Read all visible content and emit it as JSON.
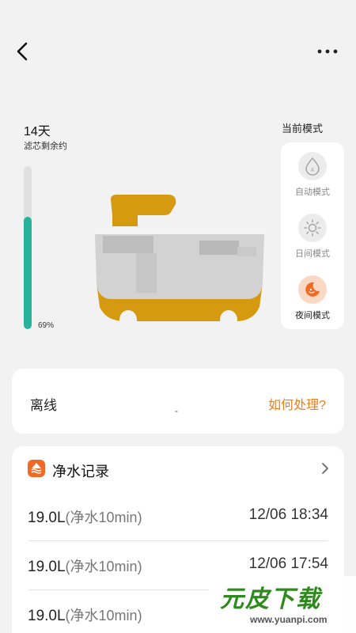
{
  "status_bar": {
    "left": "",
    "right": ""
  },
  "nav": {
    "back_icon": "chevron-left-icon",
    "more_icon": "more-horizontal-icon"
  },
  "filter": {
    "days_left": "14天",
    "label": "滤芯剩余约",
    "percent_text": "69%",
    "percent_value": 0.69,
    "fill_color": "#27b39b"
  },
  "device": {
    "image": "purifier-device-illustration",
    "accent_color": "#d69a10"
  },
  "modes": {
    "title": "当前模式",
    "items": [
      {
        "icon": "auto-mode-icon",
        "label": "自动模式",
        "active": false
      },
      {
        "icon": "sun-icon",
        "label": "日间模式",
        "active": false
      },
      {
        "icon": "moon-icon",
        "label": "夜间模式",
        "active": true
      }
    ],
    "active_color": "#ef6a24"
  },
  "status": {
    "text": "离线",
    "dash": "-",
    "help_link": "如何处理?",
    "help_color": "#f07d16"
  },
  "records": {
    "icon": "water-record-icon",
    "title": "净水记录",
    "rows": [
      {
        "volume": "19.0L",
        "note": "(净水10min)",
        "time": "12/06 18:34"
      },
      {
        "volume": "19.0L",
        "note": "(净水10min)",
        "time": "12/06 17:54"
      },
      {
        "volume": "19.0L",
        "note": "(净水10min)",
        "time": ""
      }
    ]
  },
  "watermark": {
    "main": "元皮下载",
    "url": "www.yuanpi.com"
  }
}
